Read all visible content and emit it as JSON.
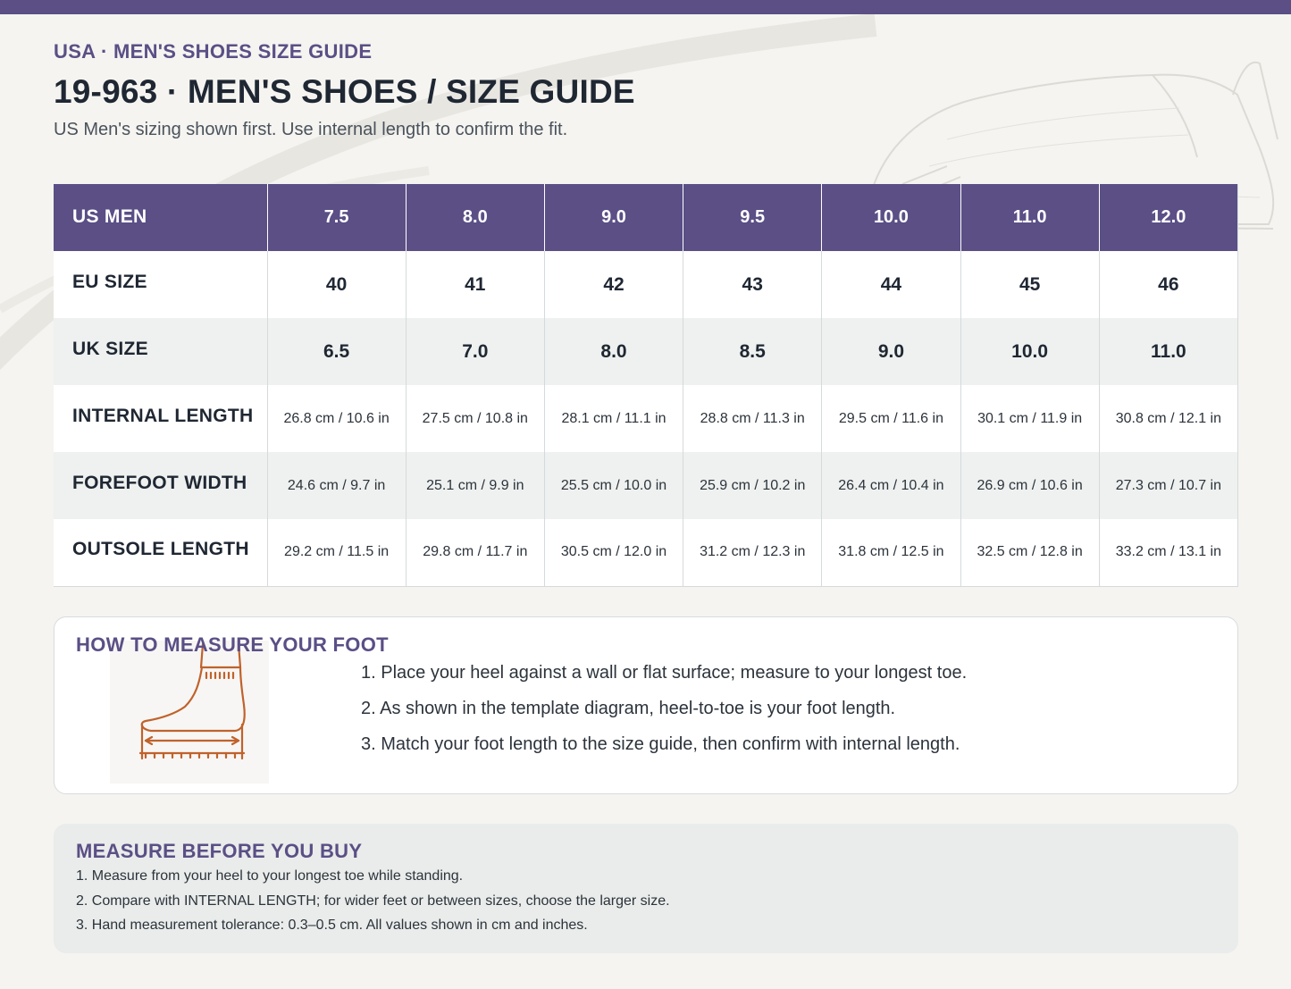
{
  "header": {
    "eyebrow": "USA · MEN'S SHOES SIZE GUIDE",
    "title": "19-963 · MEN'S SHOES / SIZE GUIDE",
    "subtitle": "US Men's sizing shown first. Use internal length to confirm the fit."
  },
  "table": {
    "header_label": "US MEN",
    "us_sizes": [
      "7.5",
      "8.0",
      "9.0",
      "9.5",
      "10.0",
      "11.0",
      "12.0"
    ],
    "rows": [
      {
        "label": "EU SIZE",
        "values": [
          "40",
          "41",
          "42",
          "43",
          "44",
          "45",
          "46"
        ]
      },
      {
        "label": "UK SIZE",
        "values": [
          "6.5",
          "7.0",
          "8.0",
          "8.5",
          "9.0",
          "10.0",
          "11.0"
        ]
      },
      {
        "label": "INTERNAL LENGTH",
        "values": [
          "26.8 cm / 10.6 in",
          "27.5 cm / 10.8 in",
          "28.1 cm / 11.1 in",
          "28.8 cm / 11.3 in",
          "29.5 cm / 11.6 in",
          "30.1 cm / 11.9 in",
          "30.8 cm / 12.1 in"
        ]
      },
      {
        "label": "FOREFOOT WIDTH",
        "values": [
          "24.6 cm / 9.7 in",
          "25.1 cm / 9.9 in",
          "25.5 cm / 10.0 in",
          "25.9 cm / 10.2 in",
          "26.4 cm / 10.4 in",
          "26.9 cm / 10.6 in",
          "27.3 cm / 10.7 in"
        ]
      },
      {
        "label": "OUTSOLE LENGTH",
        "values": [
          "29.2 cm / 11.5 in",
          "29.8 cm / 11.7 in",
          "30.5 cm / 12.0 in",
          "31.2 cm / 12.3 in",
          "31.8 cm / 12.5 in",
          "32.5 cm / 12.8 in",
          "33.2 cm / 13.1 in"
        ]
      }
    ]
  },
  "measure": {
    "title": "HOW TO MEASURE YOUR FOOT",
    "steps": [
      "1. Place your heel against a wall or flat surface; measure to your longest toe.",
      "2. As shown in the template diagram, heel-to-toe is your foot length.",
      "3. Match your foot length to the size guide, then confirm with internal length."
    ]
  },
  "tips": {
    "title": "MEASURE BEFORE YOU BUY",
    "items": [
      "1. Measure from your heel to your longest toe while standing.",
      "2. Compare with INTERNAL LENGTH; for wider feet or between sizes, choose the larger size.",
      "3. Hand measurement tolerance: 0.3–0.5 cm. All values shown in cm and inches."
    ]
  },
  "colors": {
    "accent": "#5b4f86",
    "foot_illustration": "#c0622b",
    "row_alt": "#eef1ef"
  },
  "icons": [
    "shoe-sketch-icon",
    "foot-measure-icon"
  ]
}
